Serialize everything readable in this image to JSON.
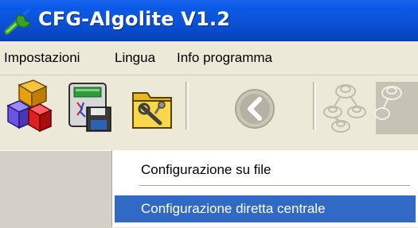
{
  "window": {
    "title": "CFG-Algolite V1.2",
    "icon": "wrench-icon"
  },
  "menubar": {
    "items": [
      "Impostazioni",
      "Lingua",
      "Info programma"
    ]
  },
  "toolbar": {
    "buttons": [
      {
        "icon": "shapes-blocks-icon",
        "enabled": true
      },
      {
        "icon": "device-save-icon",
        "enabled": true
      },
      {
        "icon": "folder-tools-icon",
        "enabled": true
      },
      {
        "icon": "back-arrow-icon",
        "enabled": false
      },
      {
        "icon": "network-nodes-icon",
        "enabled": false
      },
      {
        "icon": "network-nodes-icon",
        "enabled": false
      }
    ]
  },
  "dropdown": {
    "items": [
      {
        "label": "Configurazione su file",
        "selected": false
      },
      {
        "label": "Configurazione diretta centrale",
        "selected": true
      }
    ]
  },
  "colors": {
    "titlebar": "#0b52d6",
    "selection": "#316ac5",
    "face": "#ece9d8"
  }
}
